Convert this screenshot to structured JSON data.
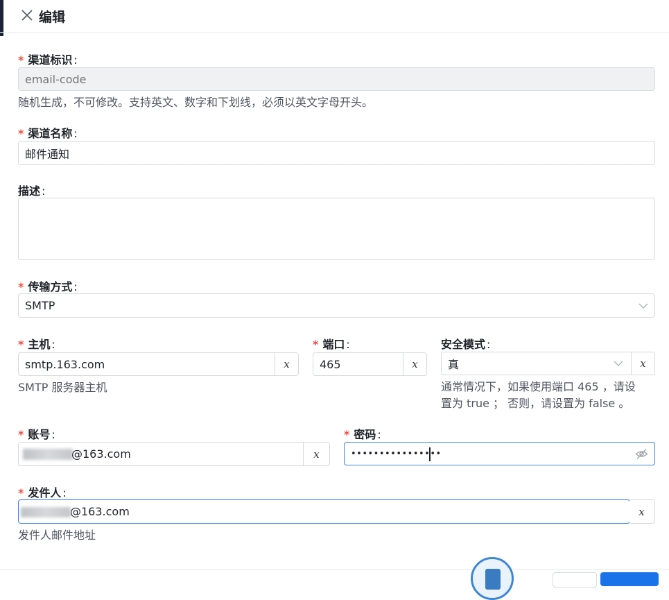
{
  "dialog": {
    "title": "编辑",
    "close_icon": "close-icon"
  },
  "colors": {
    "required": "#f04b41",
    "accent": "#3d7ff5",
    "primary": "#1a73e8"
  },
  "form": {
    "channel_id": {
      "label": "渠道标识",
      "placeholder": "email-code",
      "value": "",
      "help": "随机生成，不可修改。支持英文、数字和下划线，必须以英文字母开头。",
      "required": true,
      "disabled": true
    },
    "channel_name": {
      "label": "渠道名称",
      "value": "邮件通知",
      "required": true
    },
    "description": {
      "label": "描述",
      "value": "",
      "required": false
    },
    "transport": {
      "label": "传输方式",
      "value": "SMTP",
      "required": true
    },
    "host": {
      "label": "主机",
      "value": "smtp.163.com",
      "help": "SMTP 服务器主机",
      "clear": "x",
      "required": true
    },
    "port": {
      "label": "端口",
      "value": "465",
      "clear": "x",
      "required": true
    },
    "security": {
      "label": "安全模式",
      "value": "真",
      "clear": "x",
      "help_line1": "通常情况下，如果使用端口 465 ，请设",
      "help_line2": "置为 true ； 否则，请设置为 false 。",
      "required": false
    },
    "account": {
      "label": "账号",
      "value_visible": "@163.com",
      "clear": "x",
      "required": true
    },
    "password": {
      "label": "密码",
      "value": "••••••••••••••••",
      "eye_icon": "eye-off-icon",
      "required": true
    },
    "sender": {
      "label": "发件人",
      "value_visible": "@163.com",
      "clear": "x",
      "help": "发件人邮件地址",
      "required": true
    }
  }
}
